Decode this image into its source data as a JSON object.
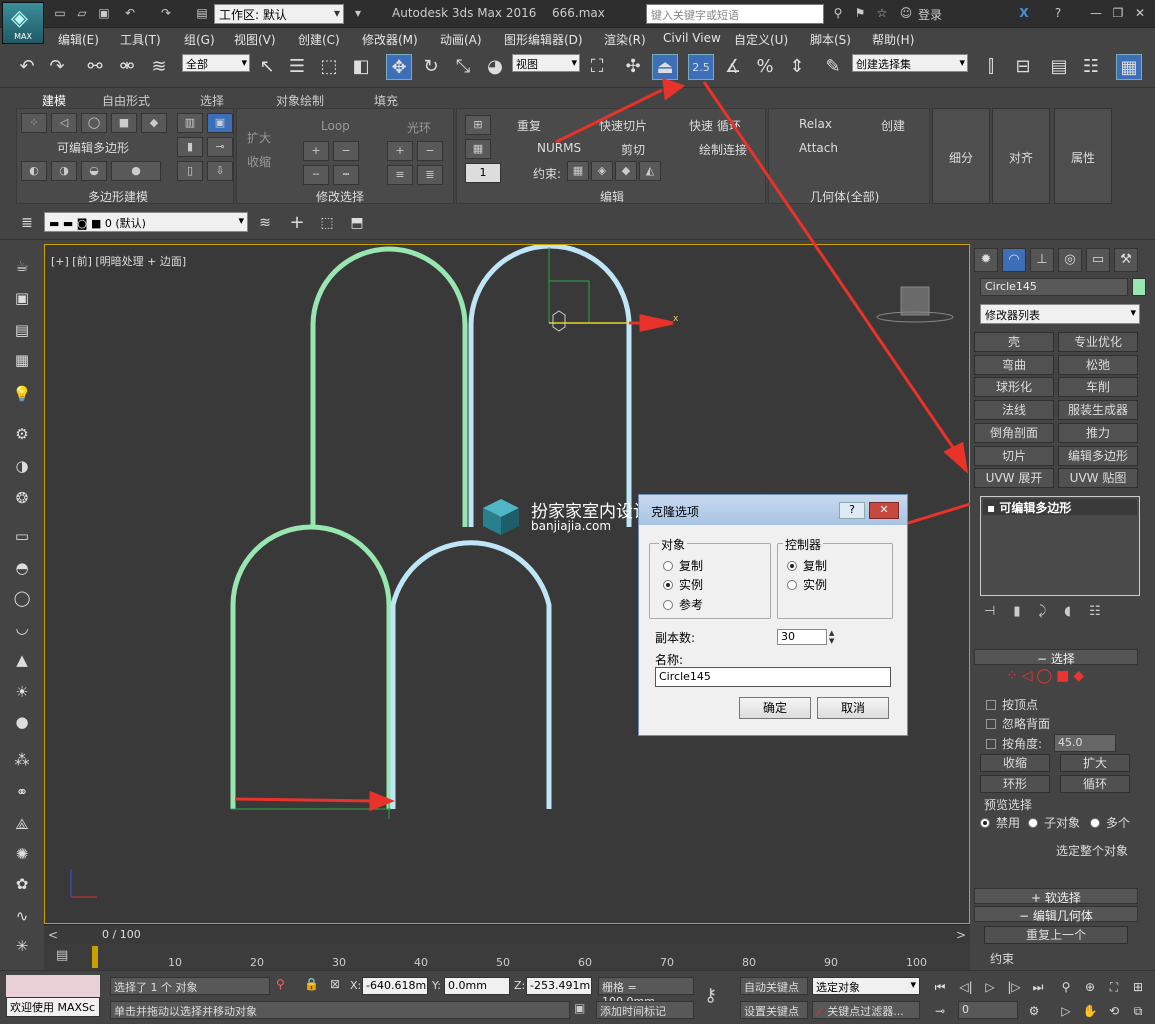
{
  "title": {
    "app": "Autodesk 3ds Max 2016",
    "file": "666.max",
    "logo_text": "MAX",
    "workspace": "工作区: 默认",
    "search_placeholder": "键入关键字或短语",
    "login": "登录"
  },
  "menu": [
    "编辑(E)",
    "工具(T)",
    "组(G)",
    "视图(V)",
    "创建(C)",
    "修改器(M)",
    "动画(A)",
    "图形编辑器(D)",
    "渲染(R)",
    "Civil View",
    "自定义(U)",
    "脚本(S)",
    "帮助(H)"
  ],
  "toolbar": {
    "filter": "全部",
    "refcoord": "视图",
    "snap_label": "2.5",
    "named_sel": "创建选择集"
  },
  "ribbon": {
    "tabs": [
      "建模",
      "自由形式",
      "选择",
      "对象绘制",
      "填充"
    ],
    "poly_label": "可编辑多边形",
    "grow": "扩大",
    "shrink": "收缩",
    "loop": "Loop",
    "ring": "光环",
    "repeat": "重复",
    "quickslice": "快速切片",
    "quickloop": "快速 循环",
    "nurms": "NURMS",
    "cut": "剪切",
    "paintconnect": "绘制连接",
    "constraint": "约束:",
    "spin_val": "1",
    "relax": "Relax",
    "create": "创建",
    "attach": "Attach",
    "subdivide": "细分",
    "align": "对齐",
    "properties": "属性",
    "groups": [
      "多边形建模",
      "修改选择",
      "编辑",
      "几何体(全部)"
    ]
  },
  "layer": {
    "name": "0 (默认)"
  },
  "viewport": {
    "label": "[+] [前] [明暗处理 + 边面]"
  },
  "watermark": {
    "line1": "扮家家室内设计",
    "line2": "banjiajia.com"
  },
  "dialog": {
    "title": "克隆选项",
    "object_group": "对象",
    "object_options": [
      "复制",
      "实例",
      "参考"
    ],
    "object_selected": 1,
    "controller_group": "控制器",
    "controller_options": [
      "复制",
      "实例"
    ],
    "controller_selected": 0,
    "copies_label": "副本数:",
    "copies_value": "30",
    "name_label": "名称:",
    "name_value": "Circle145",
    "ok": "确定",
    "cancel": "取消"
  },
  "cmdpanel": {
    "object_name": "Circle145",
    "object_color": "#98e6b0",
    "modifier_list": "修改器列表",
    "modifier_buttons": [
      "壳",
      "专业优化",
      "弯曲",
      "松弛",
      "球形化",
      "车削",
      "法线",
      "服装生成器",
      "倒角剖面",
      "推力",
      "切片",
      "编辑多边形",
      "UVW 展开",
      "UVW 贴图"
    ],
    "stack_item": "可编辑多边形",
    "selection_title": "选择",
    "by_vertex": "按顶点",
    "ignore_back": "忽略背面",
    "by_angle": "按角度:",
    "angle_value": "45.0",
    "shrink": "收缩",
    "grow": "扩大",
    "ring": "环形",
    "loop": "循环",
    "preview_title": "预览选择",
    "preview_options": [
      "禁用",
      "子对象",
      "多个"
    ],
    "select_whole": "选定整个对象",
    "soft_sel": "软选择",
    "edit_geo": "编辑几何体",
    "repeat_last": "重复上一个",
    "constraints": "约束"
  },
  "timeline": {
    "frame": "0 / 100",
    "ticks": [
      "10",
      "20",
      "30",
      "40",
      "50",
      "60",
      "70",
      "80",
      "90",
      "100"
    ]
  },
  "status": {
    "welcome": "欢迎使用 MAXSc",
    "selected": "选择了 1 个 对象",
    "hint": "单击并拖动以选择并移动对象",
    "x": "-640.618m",
    "y": "0.0mm",
    "z": "-253.491m",
    "grid": "栅格 = 100.0mm",
    "add_time_tag": "添加时间标记",
    "autokey": "自动关键点",
    "setkey": "设置关键点",
    "selected_obj": "选定对象",
    "key_filters": "关键点过滤器...",
    "frame_value": "0"
  },
  "colors": {
    "accent": "#3d6fb8",
    "viewport_border": "#c8a000",
    "shape": "#98e6b0",
    "arrow": "#e8322a"
  }
}
